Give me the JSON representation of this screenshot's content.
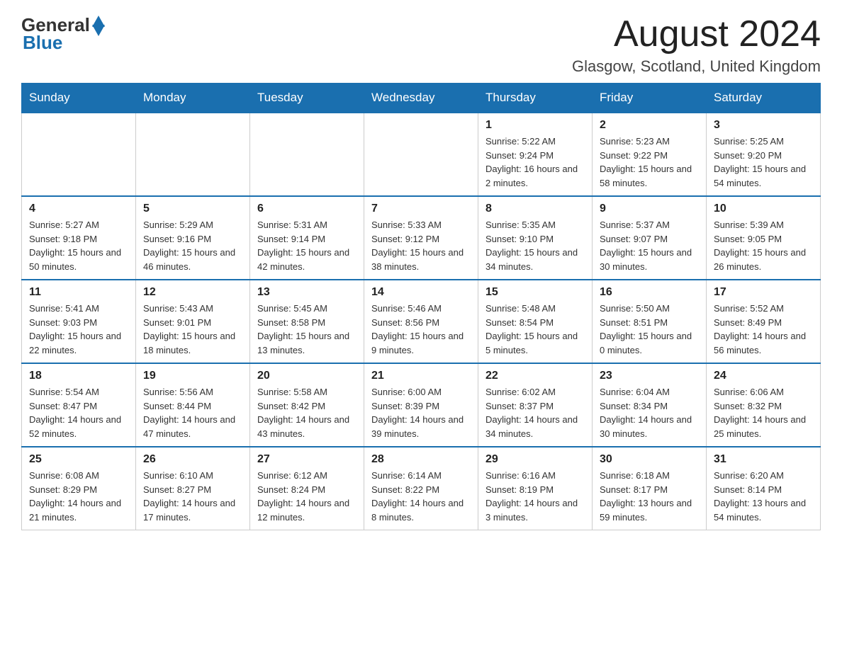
{
  "header": {
    "logo": {
      "general": "General",
      "blue": "Blue"
    },
    "title": "August 2024",
    "subtitle": "Glasgow, Scotland, United Kingdom"
  },
  "days_of_week": [
    "Sunday",
    "Monday",
    "Tuesday",
    "Wednesday",
    "Thursday",
    "Friday",
    "Saturday"
  ],
  "weeks": [
    [
      {
        "day": "",
        "info": ""
      },
      {
        "day": "",
        "info": ""
      },
      {
        "day": "",
        "info": ""
      },
      {
        "day": "",
        "info": ""
      },
      {
        "day": "1",
        "info": "Sunrise: 5:22 AM\nSunset: 9:24 PM\nDaylight: 16 hours and 2 minutes."
      },
      {
        "day": "2",
        "info": "Sunrise: 5:23 AM\nSunset: 9:22 PM\nDaylight: 15 hours and 58 minutes."
      },
      {
        "day": "3",
        "info": "Sunrise: 5:25 AM\nSunset: 9:20 PM\nDaylight: 15 hours and 54 minutes."
      }
    ],
    [
      {
        "day": "4",
        "info": "Sunrise: 5:27 AM\nSunset: 9:18 PM\nDaylight: 15 hours and 50 minutes."
      },
      {
        "day": "5",
        "info": "Sunrise: 5:29 AM\nSunset: 9:16 PM\nDaylight: 15 hours and 46 minutes."
      },
      {
        "day": "6",
        "info": "Sunrise: 5:31 AM\nSunset: 9:14 PM\nDaylight: 15 hours and 42 minutes."
      },
      {
        "day": "7",
        "info": "Sunrise: 5:33 AM\nSunset: 9:12 PM\nDaylight: 15 hours and 38 minutes."
      },
      {
        "day": "8",
        "info": "Sunrise: 5:35 AM\nSunset: 9:10 PM\nDaylight: 15 hours and 34 minutes."
      },
      {
        "day": "9",
        "info": "Sunrise: 5:37 AM\nSunset: 9:07 PM\nDaylight: 15 hours and 30 minutes."
      },
      {
        "day": "10",
        "info": "Sunrise: 5:39 AM\nSunset: 9:05 PM\nDaylight: 15 hours and 26 minutes."
      }
    ],
    [
      {
        "day": "11",
        "info": "Sunrise: 5:41 AM\nSunset: 9:03 PM\nDaylight: 15 hours and 22 minutes."
      },
      {
        "day": "12",
        "info": "Sunrise: 5:43 AM\nSunset: 9:01 PM\nDaylight: 15 hours and 18 minutes."
      },
      {
        "day": "13",
        "info": "Sunrise: 5:45 AM\nSunset: 8:58 PM\nDaylight: 15 hours and 13 minutes."
      },
      {
        "day": "14",
        "info": "Sunrise: 5:46 AM\nSunset: 8:56 PM\nDaylight: 15 hours and 9 minutes."
      },
      {
        "day": "15",
        "info": "Sunrise: 5:48 AM\nSunset: 8:54 PM\nDaylight: 15 hours and 5 minutes."
      },
      {
        "day": "16",
        "info": "Sunrise: 5:50 AM\nSunset: 8:51 PM\nDaylight: 15 hours and 0 minutes."
      },
      {
        "day": "17",
        "info": "Sunrise: 5:52 AM\nSunset: 8:49 PM\nDaylight: 14 hours and 56 minutes."
      }
    ],
    [
      {
        "day": "18",
        "info": "Sunrise: 5:54 AM\nSunset: 8:47 PM\nDaylight: 14 hours and 52 minutes."
      },
      {
        "day": "19",
        "info": "Sunrise: 5:56 AM\nSunset: 8:44 PM\nDaylight: 14 hours and 47 minutes."
      },
      {
        "day": "20",
        "info": "Sunrise: 5:58 AM\nSunset: 8:42 PM\nDaylight: 14 hours and 43 minutes."
      },
      {
        "day": "21",
        "info": "Sunrise: 6:00 AM\nSunset: 8:39 PM\nDaylight: 14 hours and 39 minutes."
      },
      {
        "day": "22",
        "info": "Sunrise: 6:02 AM\nSunset: 8:37 PM\nDaylight: 14 hours and 34 minutes."
      },
      {
        "day": "23",
        "info": "Sunrise: 6:04 AM\nSunset: 8:34 PM\nDaylight: 14 hours and 30 minutes."
      },
      {
        "day": "24",
        "info": "Sunrise: 6:06 AM\nSunset: 8:32 PM\nDaylight: 14 hours and 25 minutes."
      }
    ],
    [
      {
        "day": "25",
        "info": "Sunrise: 6:08 AM\nSunset: 8:29 PM\nDaylight: 14 hours and 21 minutes."
      },
      {
        "day": "26",
        "info": "Sunrise: 6:10 AM\nSunset: 8:27 PM\nDaylight: 14 hours and 17 minutes."
      },
      {
        "day": "27",
        "info": "Sunrise: 6:12 AM\nSunset: 8:24 PM\nDaylight: 14 hours and 12 minutes."
      },
      {
        "day": "28",
        "info": "Sunrise: 6:14 AM\nSunset: 8:22 PM\nDaylight: 14 hours and 8 minutes."
      },
      {
        "day": "29",
        "info": "Sunrise: 6:16 AM\nSunset: 8:19 PM\nDaylight: 14 hours and 3 minutes."
      },
      {
        "day": "30",
        "info": "Sunrise: 6:18 AM\nSunset: 8:17 PM\nDaylight: 13 hours and 59 minutes."
      },
      {
        "day": "31",
        "info": "Sunrise: 6:20 AM\nSunset: 8:14 PM\nDaylight: 13 hours and 54 minutes."
      }
    ]
  ]
}
